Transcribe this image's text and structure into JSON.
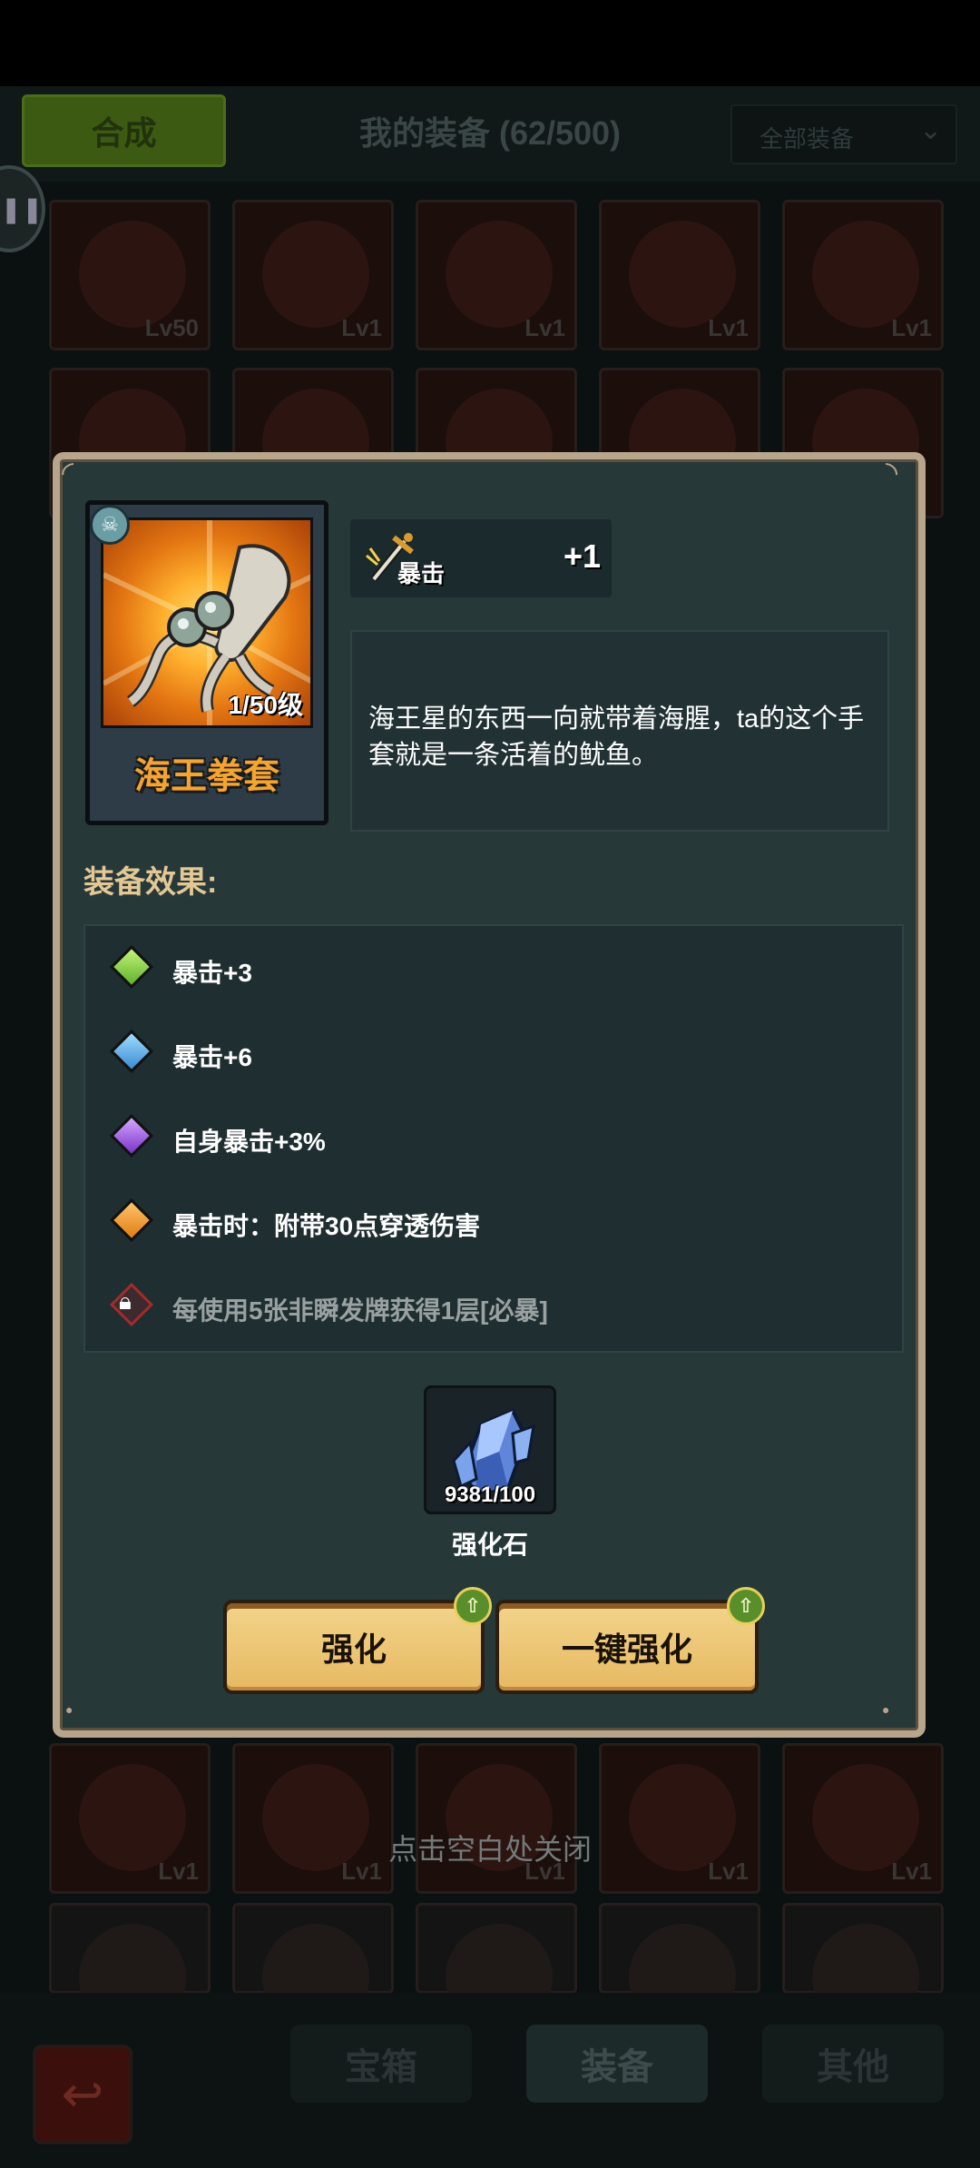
{
  "background": {
    "compose_button": "合成",
    "equipment_title": "我的装备 (62/500)",
    "filter_select": "全部装备",
    "tiles_row1": [
      "Lv50",
      "Lv1",
      "Lv1",
      "Lv1",
      "Lv1"
    ],
    "tiles_row3": [
      "Lv1",
      "Lv1",
      "Lv1",
      "Lv1",
      "Lv1"
    ],
    "close_hint": "点击空白处关闭",
    "tabs": [
      "宝箱",
      "装备",
      "其他"
    ],
    "active_tab": "装备"
  },
  "item": {
    "name": "海王拳套",
    "level": "1/50级",
    "name_color": "#f4a430",
    "icon": "squid-glove-icon",
    "stat": {
      "label": "暴击",
      "value": "+1",
      "icon": "sword-icon"
    },
    "description": "海王星的东西一向就带着海腥，ta的这个手套就是一条活着的鱿鱼。"
  },
  "effects": {
    "title": "装备效果:",
    "items": [
      {
        "text": "暴击+3",
        "gem": "green-gem-icon",
        "color": "#6fc03a"
      },
      {
        "text": "暴击+6",
        "gem": "blue-gem-icon",
        "color": "#4a9fe0"
      },
      {
        "text": "自身暴击+3%",
        "gem": "purple-gem-icon",
        "color": "#8a44d4"
      },
      {
        "text": "暴击时：附带30点穿透伤害",
        "gem": "orange-gem-icon",
        "color": "#ea8a1a"
      },
      {
        "text": "每使用5张非瞬发牌获得1层[必暴]",
        "gem": "locked-gem-icon",
        "locked": true
      }
    ]
  },
  "material": {
    "name": "强化石",
    "count": "9381/100",
    "icon": "crystal-stone-icon"
  },
  "buttons": {
    "enhance": "强化",
    "enhance_all": "一键强化"
  }
}
